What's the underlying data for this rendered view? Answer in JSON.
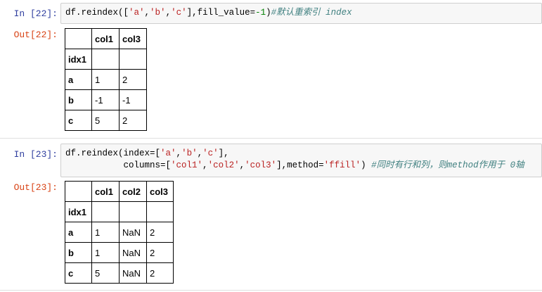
{
  "cell22": {
    "in_prompt": "In  [22]:",
    "out_prompt": "Out[22]:",
    "code": {
      "p1": "df.reindex([",
      "s1": "'a'",
      "p2": ",",
      "s2": "'b'",
      "p3": ",",
      "s3": "'c'",
      "p4": "],fill_value=",
      "n1": "-1",
      "p5": ")",
      "comment": "#默认重索引 index"
    },
    "table": {
      "columns": [
        "col1",
        "col3"
      ],
      "index_name": "idx1",
      "rows": [
        {
          "idx": "a",
          "vals": [
            "1",
            "2"
          ]
        },
        {
          "idx": "b",
          "vals": [
            "-1",
            "-1"
          ]
        },
        {
          "idx": "c",
          "vals": [
            "5",
            "2"
          ]
        }
      ]
    }
  },
  "cell23": {
    "in_prompt": "In  [23]:",
    "out_prompt": "Out[23]:",
    "code": {
      "l1a": "df.reindex(index=[",
      "l1s1": "'a'",
      "l1b": ",",
      "l1s2": "'b'",
      "l1c": ",",
      "l1s3": "'c'",
      "l1d": "],",
      "l2a": "           columns=[",
      "l2s1": "'col1'",
      "l2b": ",",
      "l2s2": "'col2'",
      "l2c": ",",
      "l2s3": "'col3'",
      "l2d": "],method=",
      "l2s4": "'ffill'",
      "l2e": ") ",
      "comment": "#同时有行和列，则method作用于 0轴"
    },
    "table": {
      "columns": [
        "col1",
        "col2",
        "col3"
      ],
      "index_name": "idx1",
      "rows": [
        {
          "idx": "a",
          "vals": [
            "1",
            "NaN",
            "2"
          ]
        },
        {
          "idx": "b",
          "vals": [
            "1",
            "NaN",
            "2"
          ]
        },
        {
          "idx": "c",
          "vals": [
            "5",
            "NaN",
            "2"
          ]
        }
      ]
    }
  }
}
